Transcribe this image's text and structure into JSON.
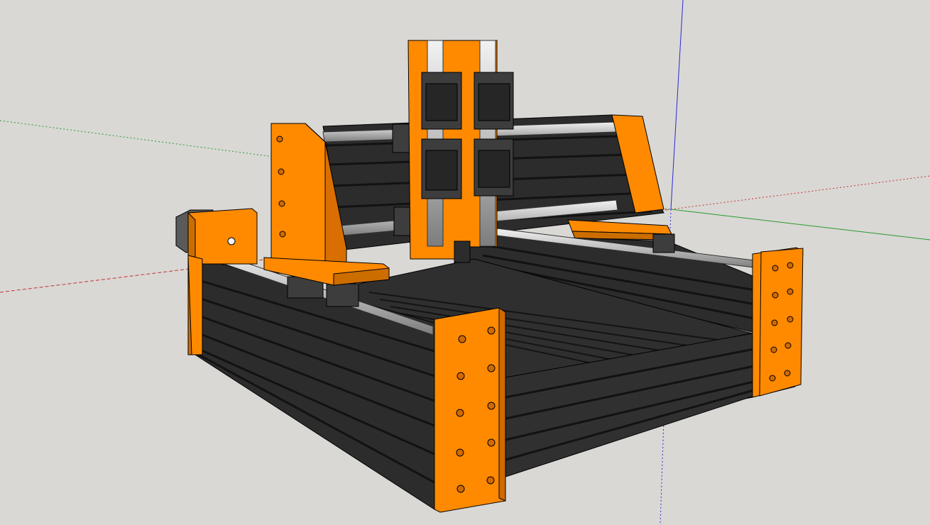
{
  "viewport": {
    "background": "#d9d8d5",
    "axes": {
      "red": "#c8312f",
      "green": "#2a9a2a",
      "blue": "#2b2bd0"
    }
  },
  "model": {
    "plate_color": "#ff8a00",
    "extrusion_color": "#2c2c2c",
    "extrusion_slot_color": "#151515",
    "rail_color": "#c8c8c8",
    "carriage_color": "#3d3d3d",
    "motor_color": "#5a5a5a"
  }
}
